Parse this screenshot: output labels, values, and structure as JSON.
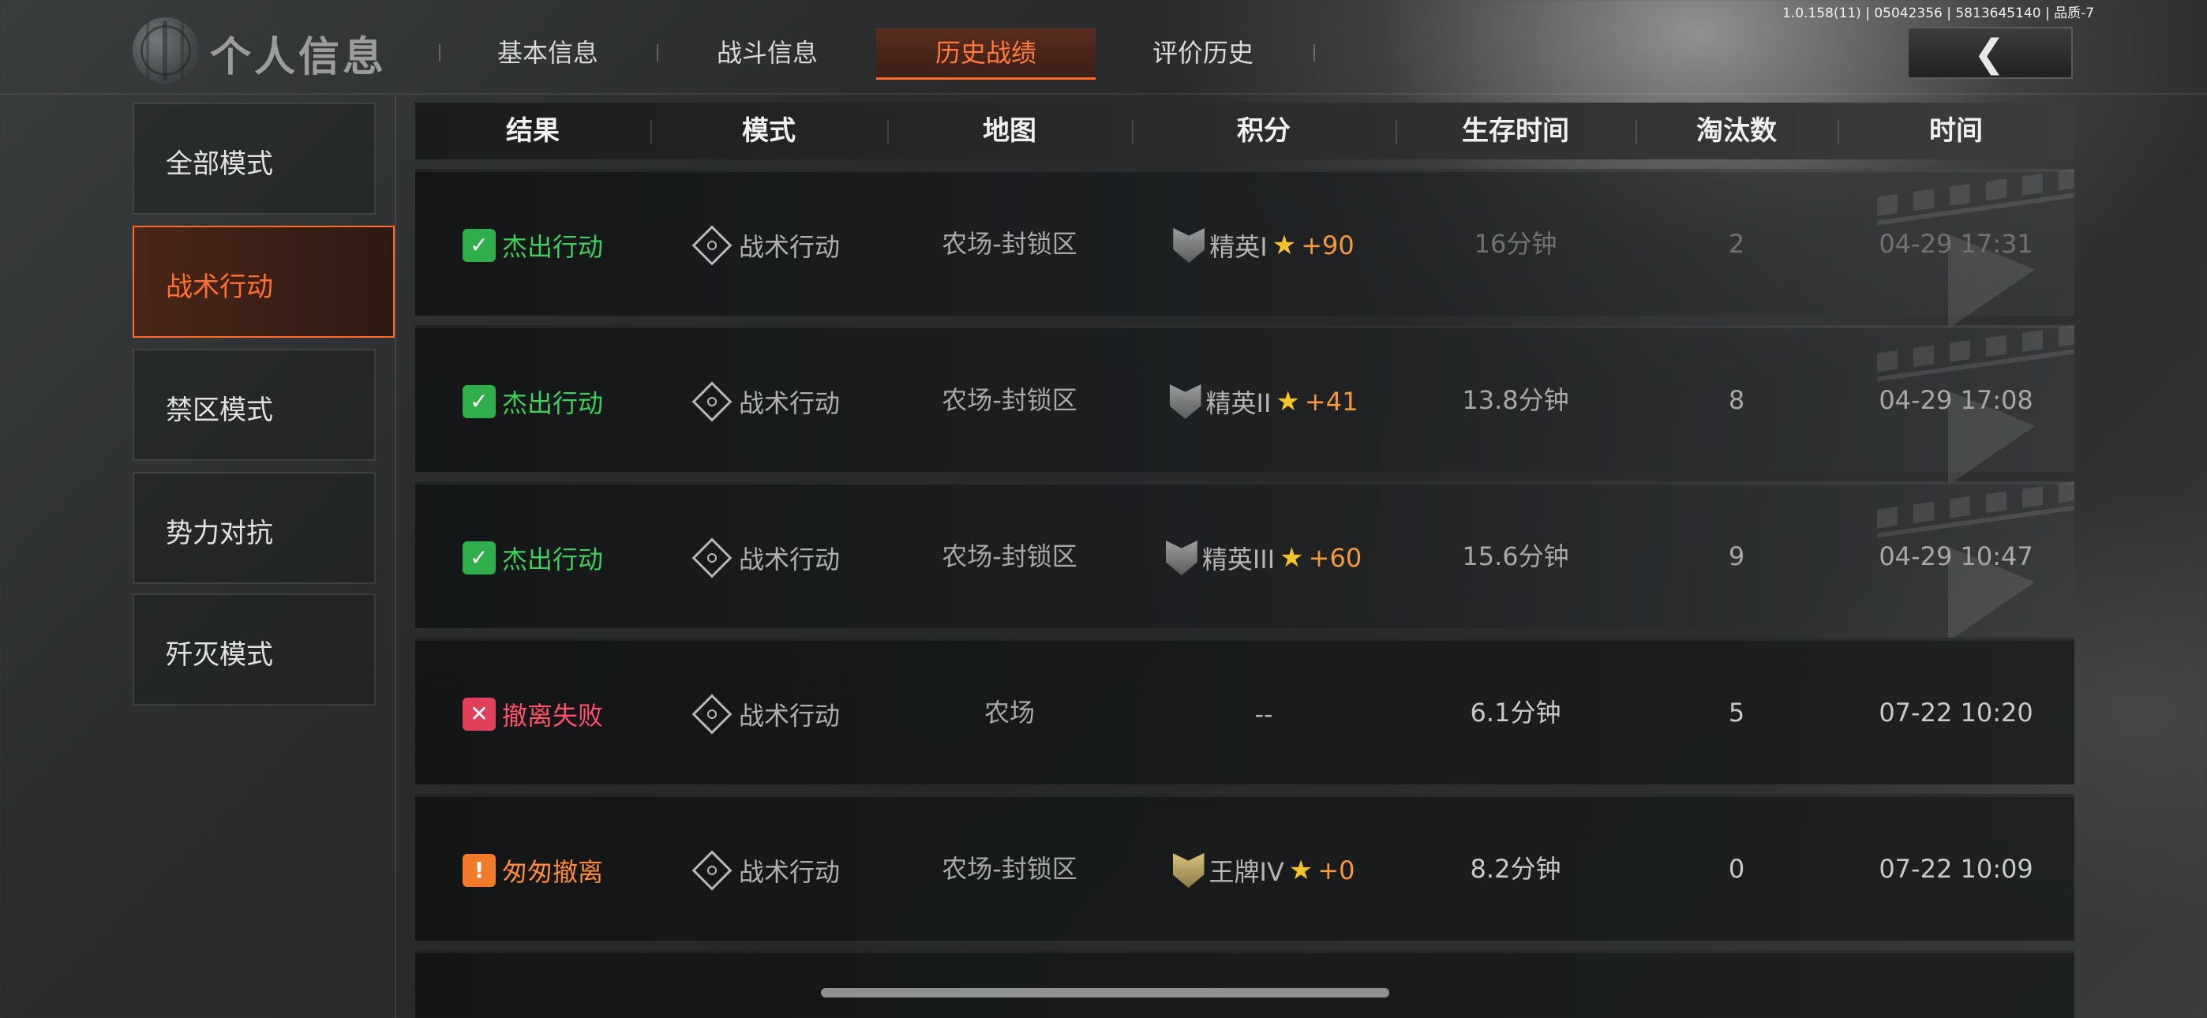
{
  "header": {
    "title": "个人信息",
    "tabs": [
      {
        "label": "基本信息",
        "active": false
      },
      {
        "label": "战斗信息",
        "active": false
      },
      {
        "label": "历史战绩",
        "active": true
      },
      {
        "label": "评价历史",
        "active": false
      }
    ],
    "back_icon": "chevron-left-icon",
    "version": "1.0.158(11) | 05042356 | 5813645140 | 品质-7"
  },
  "sidebar": {
    "items": [
      {
        "label": "全部模式",
        "active": false
      },
      {
        "label": "战术行动",
        "active": true
      },
      {
        "label": "禁区模式",
        "active": false
      },
      {
        "label": "势力对抗",
        "active": false
      },
      {
        "label": "歼灭模式",
        "active": false
      }
    ]
  },
  "table": {
    "columns": [
      "结果",
      "模式",
      "地图",
      "积分",
      "生存时间",
      "淘汰数",
      "时间"
    ],
    "rows": [
      {
        "result": "杰出行动",
        "result_type": "success",
        "mode": "战术行动",
        "map": "农场-封锁区",
        "rank": "精英I",
        "star": "★",
        "points": "+90",
        "survival": "16分钟",
        "kills": "2",
        "time": "04-29 17:31"
      },
      {
        "result": "杰出行动",
        "result_type": "success",
        "mode": "战术行动",
        "map": "农场-封锁区",
        "rank": "精英II",
        "star": "★",
        "points": "+41",
        "survival": "13.8分钟",
        "kills": "8",
        "time": "04-29 17:08"
      },
      {
        "result": "杰出行动",
        "result_type": "success",
        "mode": "战术行动",
        "map": "农场-封锁区",
        "rank": "精英III",
        "star": "★",
        "points": "+60",
        "survival": "15.6分钟",
        "kills": "9",
        "time": "04-29 10:47"
      },
      {
        "result": "撤离失败",
        "result_type": "fail",
        "mode": "战术行动",
        "map": "农场",
        "rank": "--",
        "star": "",
        "points": "",
        "survival": "6.1分钟",
        "kills": "5",
        "time": "07-22 10:20"
      },
      {
        "result": "匆匆撤离",
        "result_type": "hasty",
        "mode": "战术行动",
        "map": "农场-封锁区",
        "rank": "王牌IV",
        "star": "★",
        "points": "+0",
        "survival": "8.2分钟",
        "kills": "0",
        "time": "07-22 10:09"
      }
    ]
  },
  "colors": {
    "accent": "#ff6a2a",
    "success": "#3fd05a",
    "fail": "#ff5168",
    "hasty": "#ff8a3a",
    "points": "#f59a3a"
  }
}
